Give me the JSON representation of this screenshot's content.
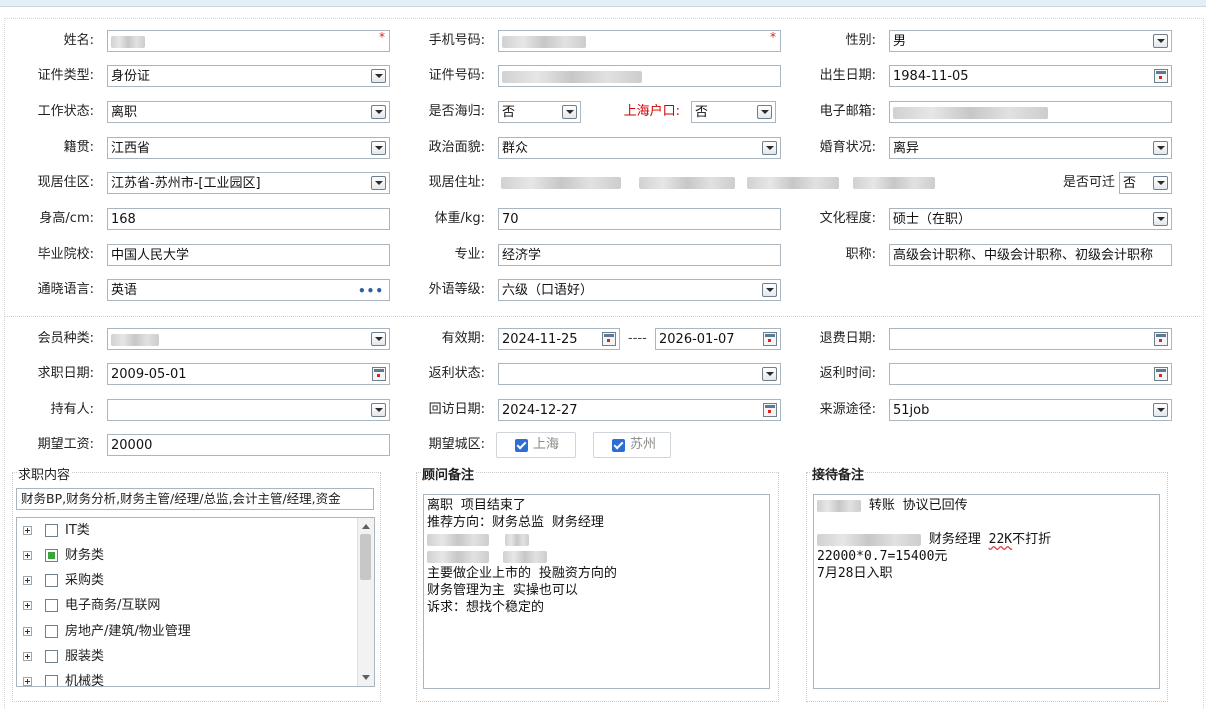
{
  "basic": {
    "name_label": "姓名:",
    "phone_label": "手机号码:",
    "gender_label": "性别:",
    "gender_value": "男",
    "idtype_label": "证件类型:",
    "idtype_value": "身份证",
    "idno_label": "证件号码:",
    "birth_label": "出生日期:",
    "birth_value": "1984-11-05",
    "workstatus_label": "工作状态:",
    "workstatus_value": "离职",
    "returnee_label": "是否海归:",
    "returnee_value": "否",
    "shhukou_label": "上海户口:",
    "shhukou_value": "否",
    "email_label": "电子邮箱:",
    "native_label": "籍贯:",
    "native_value": "江西省",
    "political_label": "政治面貌:",
    "political_value": "群众",
    "marital_label": "婚育状况:",
    "marital_value": "离异",
    "residence_label": "现居住区:",
    "residence_value": "江苏省-苏州市-[工业园区]",
    "address_label": "现居住址:",
    "relocate_label": "是否可迁",
    "relocate_value": "否",
    "height_label": "身高/cm:",
    "height_value": "168",
    "weight_label": "体重/kg:",
    "weight_value": "70",
    "edu_label": "文化程度:",
    "edu_value": "硕士（在职）",
    "school_label": "毕业院校:",
    "school_value": "中国人民大学",
    "major_label": "专业:",
    "major_value": "经济学",
    "title_label": "职称:",
    "title_value": "高级会计职称、中级会计职称、初级会计职称",
    "lang_label": "通晓语言:",
    "lang_value": "英语",
    "lang_more": "•••",
    "foreign_label": "外语等级:",
    "foreign_value": "六级（口语好）",
    "required_mark": "*"
  },
  "member": {
    "type_label": "会员种类:",
    "valid_label": "有效期:",
    "valid_from": "2024-11-25",
    "valid_sep": "----",
    "valid_to": "2026-01-07",
    "refund_label": "退费日期:",
    "jobdate_label": "求职日期:",
    "jobdate_value": "2009-05-01",
    "rebate_label": "返利状态:",
    "rebatetime_label": "返利时间:",
    "holder_label": "持有人:",
    "revisit_label": "回访日期:",
    "revisit_value": "2024-12-27",
    "source_label": "来源途径:",
    "source_value": "51job",
    "salary_label": "期望工资:",
    "salary_value": "20000",
    "city_label": "期望城区:",
    "city_options": [
      "上海",
      "苏州"
    ]
  },
  "job_content": {
    "legend": "求职内容",
    "summary": "财务BP,财务分析,财务主管/经理/总监,会计主管/经理,资金",
    "tree": [
      "IT类",
      "财务类",
      "采购类",
      "电子商务/互联网",
      "房地产/建筑/物业管理",
      "服装类",
      "机械类"
    ]
  },
  "consultant_notes": {
    "legend": "顾问备注",
    "lines": [
      "离职 项目结束了",
      "推荐方向：财务总监  财务经理",
      "",
      "",
      "主要做企业上市的 投融资方向的",
      "财务管理为主 实操也可以",
      "诉求：想找个稳定的"
    ]
  },
  "reception_notes": {
    "legend": "接待备注",
    "line1_tail": " 转账  协议已回传",
    "line3_tail": " 财务经理  ",
    "line3_emph": "22K",
    "line3_end": "不打折",
    "line4": "22000*0.7=15400元",
    "line5": "7月28日入职"
  }
}
